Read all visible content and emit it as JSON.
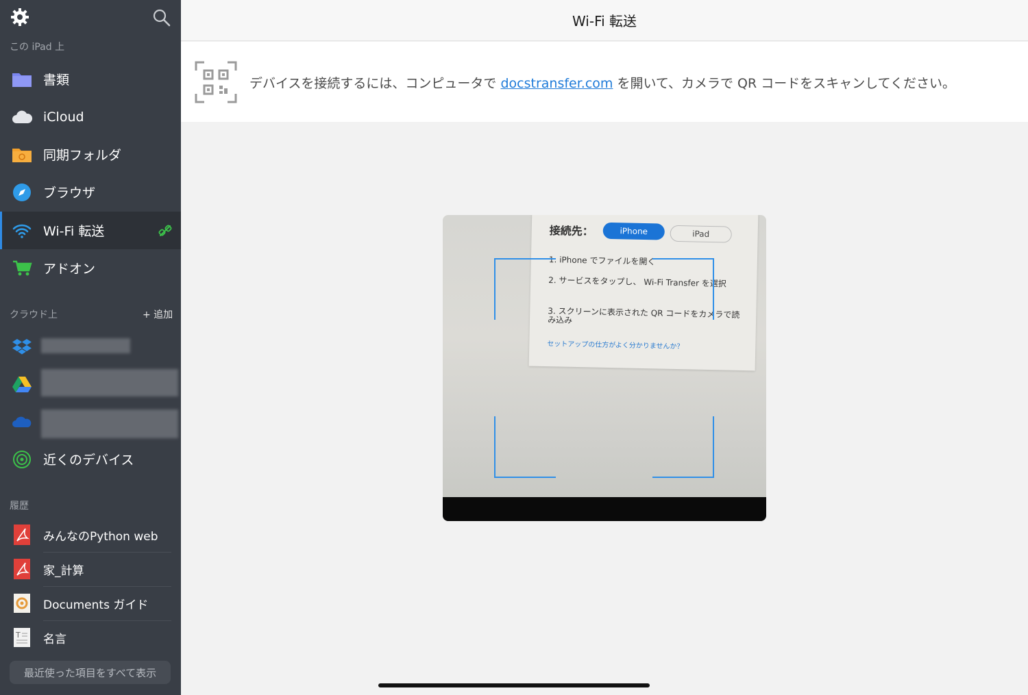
{
  "sidebar": {
    "section_local": "この iPad 上",
    "section_cloud": "クラウド上",
    "add_label": "+ 追加",
    "section_history": "履歴",
    "items": [
      {
        "label": "書類",
        "icon": "folder-icon"
      },
      {
        "label": "iCloud",
        "icon": "cloud-icon"
      },
      {
        "label": "同期フォルダ",
        "icon": "sync-folder-icon"
      },
      {
        "label": "ブラウザ",
        "icon": "compass-icon"
      },
      {
        "label": "Wi-Fi 転送",
        "icon": "wifi-icon",
        "selected": true
      },
      {
        "label": "アドオン",
        "icon": "cart-icon"
      }
    ],
    "cloud_services": [
      {
        "icon": "dropbox-icon"
      },
      {
        "icon": "google-drive-icon"
      },
      {
        "icon": "onedrive-icon"
      }
    ],
    "nearby_label": "近くのデバイス",
    "history": [
      {
        "label": "みんなのPython web",
        "icon": "pdf-icon"
      },
      {
        "label": "家_計算",
        "icon": "pdf-icon"
      },
      {
        "label": "Documents ガイド",
        "icon": "guide-icon"
      },
      {
        "label": "名言",
        "icon": "text-file-icon"
      }
    ],
    "recent_button": "最近使った項目をすべて表示"
  },
  "header": {
    "title": "Wi-Fi 転送"
  },
  "info": {
    "text_before": "デバイスを接続するには、コンピュータで ",
    "link": "docstransfer.com",
    "text_after": " を開いて、カメラで QR コードをスキャンしてください。"
  },
  "camera": {
    "connect_label": "接続先：",
    "seg_iphone": "iPhone",
    "seg_ipad": "iPad",
    "step1": "1. iPhone でファイルを開く",
    "step2": "2.       サービスをタップし、 Wi-Fi Transfer を選択",
    "step3": "3. スクリーンに表示された QR コードをカメラで読み込み",
    "help_link": "セットアップの仕方がよく分かりませんか？"
  },
  "colors": {
    "sidebar_bg": "#393e46",
    "accent": "#2f8be6",
    "link": "#1f7bd9"
  }
}
